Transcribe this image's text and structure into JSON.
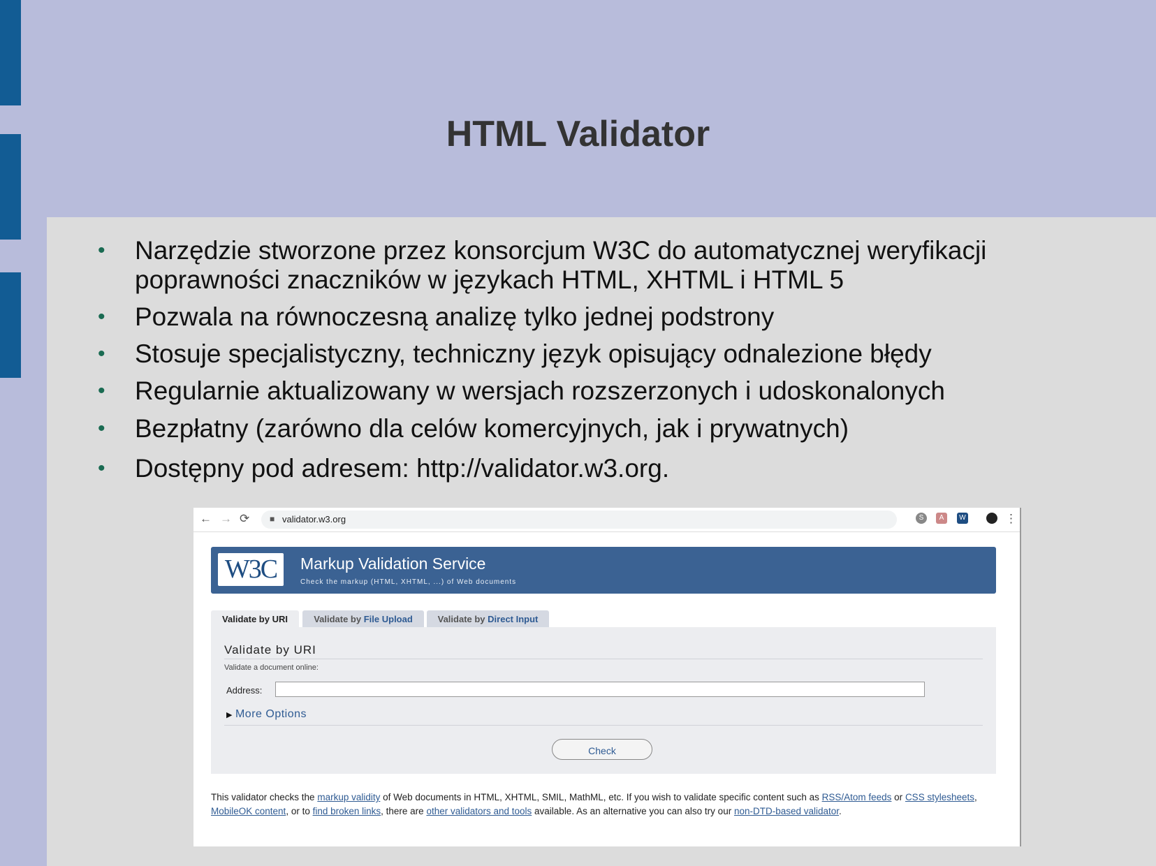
{
  "slide": {
    "title": "HTML Validator",
    "bullets": [
      {
        "line1": "Narzędzie stworzone przez konsorcjum W3C do automatycznej weryfikacji",
        "line2": "poprawności znaczników w językach HTML, XHTML i HTML 5"
      },
      {
        "line1": "Pozwala na równoczesną analizę tylko jednej podstrony"
      },
      {
        "line1": "Stosuje specjalistyczny, techniczny język opisujący odnalezione błędy"
      },
      {
        "line1": "Regularnie aktualizowany w wersjach rozszerzonych i udoskonalonych"
      },
      {
        "line1": "Bezpłatny (zarówno dla celów komercyjnych, jak i prywatnych)"
      },
      {
        "line1": "Dostępny pod adresem: http://validator.w3.org."
      }
    ],
    "bullet_glyph": "•",
    "colors": {
      "background": "#b8bcdb",
      "content_bg": "#dcdcdc",
      "side_bars": "#125c94",
      "bullet": "#1a6b52"
    }
  },
  "browser": {
    "back_icon": "←",
    "forward_icon": "→",
    "reload_icon": "⟳",
    "url": "validator.w3.org",
    "star_icon": "☆",
    "menu_icon": "⋮"
  },
  "w3c": {
    "logo_text": "W3C",
    "title": "Markup Validation Service",
    "subtitle": "Check the markup (HTML, XHTML, ...) of Web documents",
    "tabs": [
      {
        "prefix": "Validate by ",
        "highlight": "URI"
      },
      {
        "prefix": "Validate by ",
        "highlight": "File Upload"
      },
      {
        "prefix": "Validate by ",
        "highlight": "Direct Input"
      }
    ],
    "panel_title": "Validate by URI",
    "panel_desc": "Validate a document online:",
    "address_label": "Address:",
    "address_value": "",
    "more_options": "More Options",
    "more_options_icon": "▶",
    "check_label": "Check",
    "footer": {
      "t1": "This validator checks the ",
      "l1": "markup validity",
      "t2": " of Web documents in HTML, XHTML, SMIL, MathML, etc. If you wish to validate specific content such as ",
      "l2": "RSS/Atom feeds",
      "t3": " or ",
      "l3": "CSS stylesheets",
      "t4": ", ",
      "l4": "MobileOK content",
      "t5": ", or to ",
      "l5": "find broken links",
      "t6": ", there are ",
      "l6": "other validators and tools",
      "t7": " available. As an alternative you can also try our ",
      "l7": "non-DTD-based validator",
      "t8": "."
    }
  }
}
